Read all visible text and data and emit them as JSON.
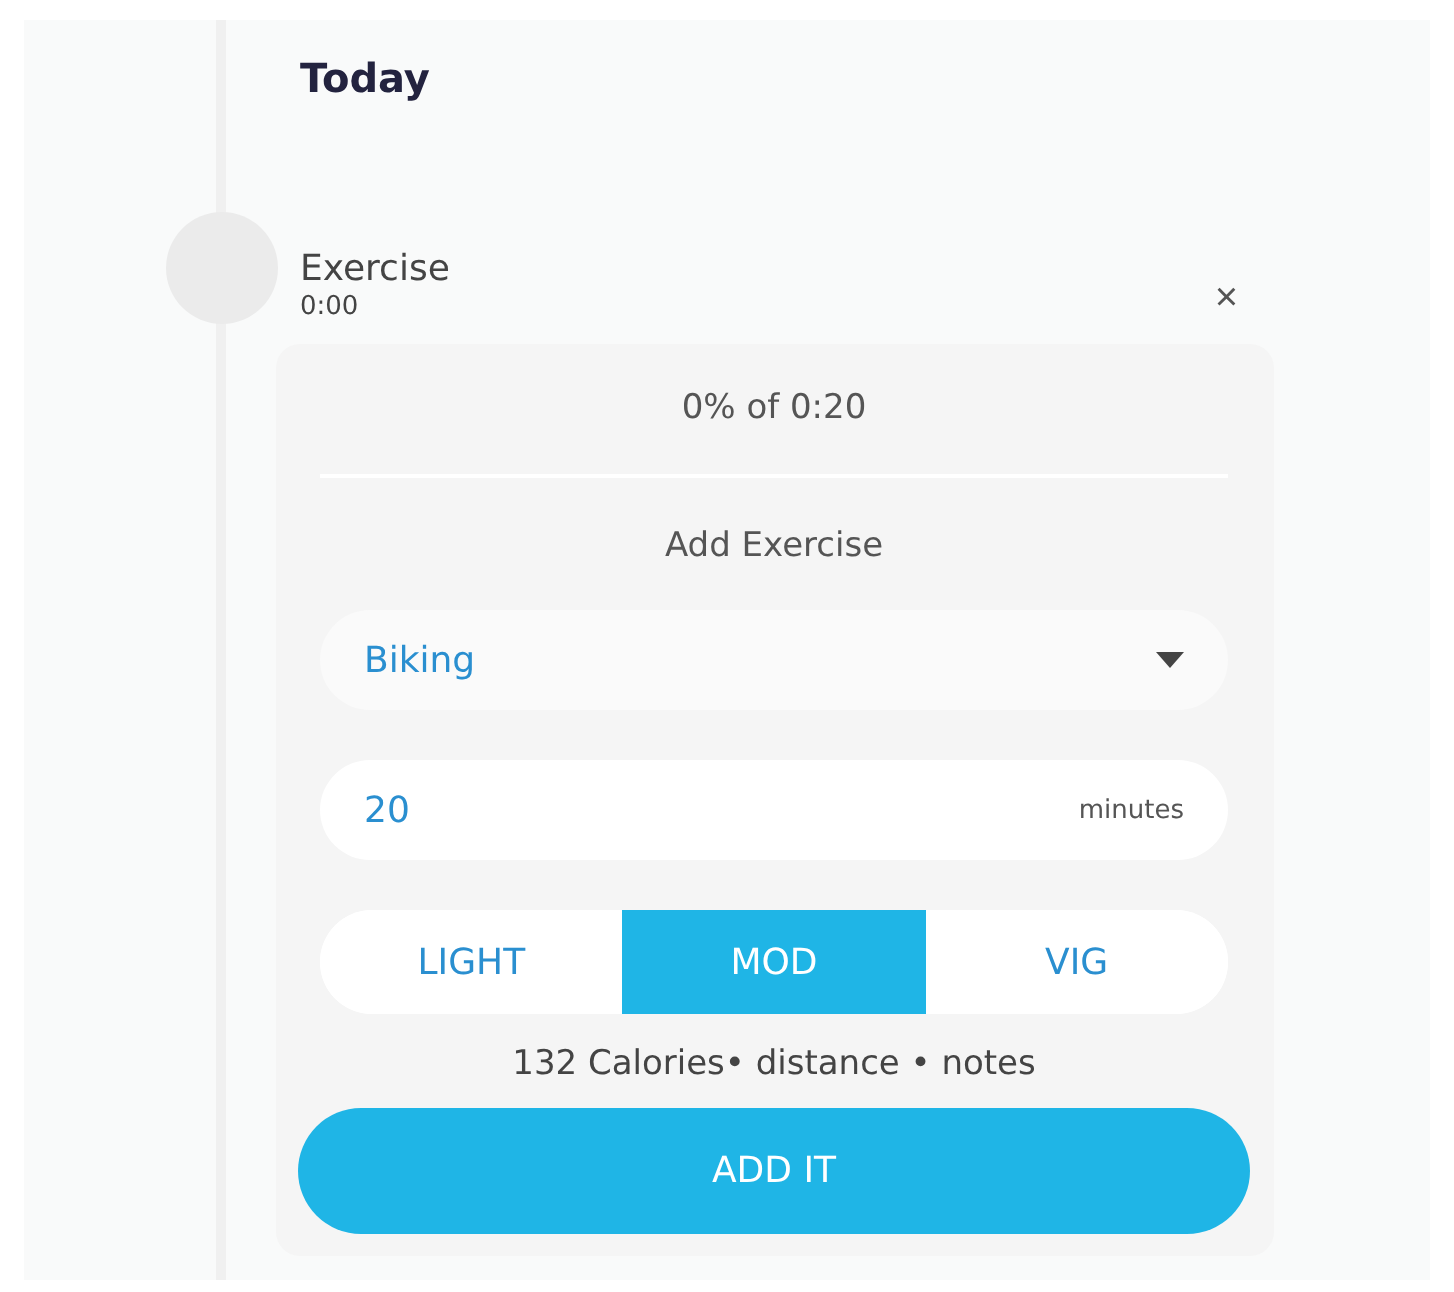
{
  "section_title": "Today",
  "entry": {
    "title": "Exercise",
    "time": "0:00",
    "close": "×"
  },
  "card": {
    "progress": "0% of 0:20",
    "heading": "Add Exercise",
    "activity": "Biking",
    "duration": {
      "value": "20",
      "unit": "minutes"
    },
    "intensity": [
      {
        "label": "LIGHT",
        "selected": false
      },
      {
        "label": "MOD",
        "selected": true
      },
      {
        "label": "VIG",
        "selected": false
      }
    ],
    "summary": "132 Calories• distance • notes",
    "submit": "ADD IT"
  }
}
